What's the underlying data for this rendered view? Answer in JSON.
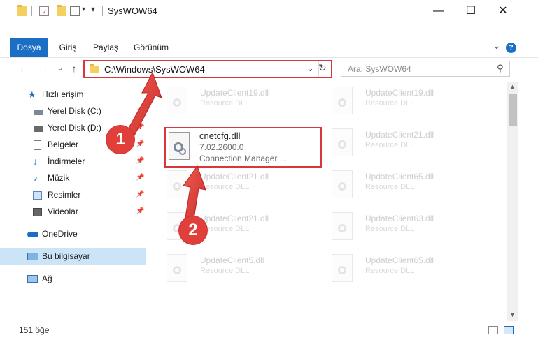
{
  "window": {
    "title": "SysWOW64",
    "minimize": "—",
    "maximize": "☐",
    "close": "✕"
  },
  "ribbon": {
    "tabs": [
      "Dosya",
      "Giriş",
      "Paylaş",
      "Görünüm"
    ],
    "expand_icon": "⌄",
    "help_icon": "?"
  },
  "nav": {
    "back": "←",
    "forward": "→",
    "recent": "⌄",
    "up": "↑"
  },
  "address": {
    "path": "C:\\Windows\\SysWOW64",
    "dropdown": "⌄",
    "refresh": "↻"
  },
  "search": {
    "placeholder": "Ara: SysWOW64",
    "icon": "⚲"
  },
  "sidebar": {
    "quick_access": "Hızlı erişim",
    "items": [
      {
        "label": "Yerel Disk (C:)",
        "icon": "drive-icon",
        "pinned": true
      },
      {
        "label": "Yerel Disk (D:)",
        "icon": "drive-icon",
        "pinned": true
      },
      {
        "label": "Belgeler",
        "icon": "documents-icon",
        "pinned": true
      },
      {
        "label": "İndirmeler",
        "icon": "downloads-icon",
        "pinned": true
      },
      {
        "label": "Müzik",
        "icon": "music-icon",
        "pinned": true
      },
      {
        "label": "Resimler",
        "icon": "pictures-icon",
        "pinned": true
      },
      {
        "label": "Videolar",
        "icon": "videos-icon",
        "pinned": true
      }
    ],
    "onedrive": "OneDrive",
    "this_pc": "Bu bilgisayar",
    "network": "Ağ"
  },
  "files": {
    "left_column": [
      {
        "name": "UpdateClient19.dll",
        "sub": "Resource DLL"
      },
      {
        "name": "UpdateClient21.dll",
        "sub": "Resource DLL"
      },
      {
        "name": "UpdateClient21.dll",
        "sub": "Resource DLL"
      },
      {
        "name": "UpdateClient5.dll",
        "sub": "Resource DLL"
      }
    ],
    "right_column": [
      {
        "name": "UpdateClient19.dll",
        "sub": "Resource DLL"
      },
      {
        "name": "UpdateClient21.dll",
        "sub": "Resource DLL"
      },
      {
        "name": "UpdateClient65.dll",
        "sub": "Resource DLL"
      },
      {
        "name": "UpdateClient63.dll",
        "sub": "Resource DLL"
      },
      {
        "name": "UpdateClient65.dll",
        "sub": "Resource DLL"
      }
    ],
    "selected": {
      "name": "cnetcfg.dll",
      "version": "7.02.2600.0",
      "description": "Connection Manager ..."
    }
  },
  "status": {
    "count": "151 öğe"
  },
  "annotations": {
    "step1": "1",
    "step2": "2"
  },
  "colors": {
    "accent": "#1a6fc4",
    "highlight": "#d9373f"
  }
}
